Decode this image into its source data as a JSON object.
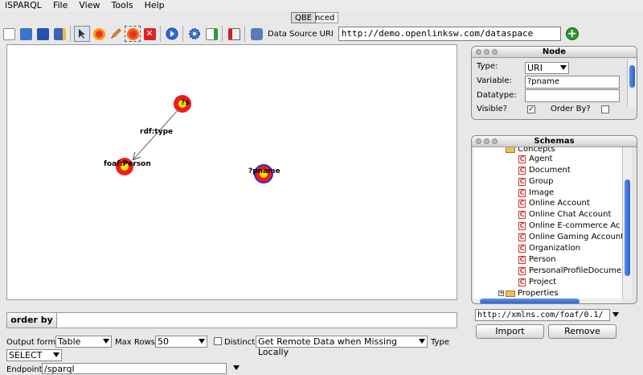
{
  "menu": [
    "iSPARQL",
    "File",
    "View",
    "Tools",
    "Help"
  ],
  "tabs": [
    {
      "label": "QBE",
      "selected": true
    },
    {
      "label": "Advanced",
      "selected": false
    }
  ],
  "toolbar": {
    "icons": [
      "new-icon",
      "open-icon",
      "save-icon",
      "save-as-icon",
      "select-icon",
      "add-node-icon",
      "edit-icon",
      "group-icon",
      "delete-icon",
      "run-icon",
      "settings-icon",
      "load-icon",
      "clear-icon",
      "datasource-icon"
    ],
    "data_source_label": "Data Source URI",
    "data_source_value": "http://demo.openlinksw.com/dataspace"
  },
  "graph": {
    "nodes": [
      {
        "id": "s",
        "label": "?s"
      },
      {
        "id": "person",
        "label": "foaf:Person"
      },
      {
        "id": "pname",
        "label": "?pname"
      }
    ],
    "edges": [
      {
        "from": "s",
        "to": "person",
        "label": "rdf:type"
      }
    ]
  },
  "node_panel": {
    "title": "Node",
    "type_label": "Type:",
    "type_value": "URI",
    "variable_label": "Variable:",
    "variable_value": "?pname",
    "datatype_label": "Datatype:",
    "datatype_value": "",
    "visible_label": "Visible?",
    "visible_checked": true,
    "orderby_label": "Order By?",
    "orderby_checked": false
  },
  "schemas_panel": {
    "title": "Schemas",
    "folder_top": "Concepts",
    "concepts": [
      "Agent",
      "Document",
      "Group",
      "Image",
      "Online Account",
      "Online Chat Account",
      "Online E-commerce Ac",
      "Online Gaming Account",
      "Organization",
      "Person",
      "PersonalProfileDocumen",
      "Project"
    ],
    "folder_bottom": "Properties",
    "schema_uri": "http://xmlns.com/foaf/0.1/",
    "import_label": "Import",
    "remove_label": "Remove"
  },
  "orderby_label": "order by",
  "bottom": {
    "output_format_label": "Output format",
    "output_format_value": "Table",
    "max_rows_label": "Max Rows",
    "max_rows_value": "50",
    "distinct_label": "Distinct",
    "distinct_checked": false,
    "remote_value": "Get Remote Data when Missing Locally",
    "type_label": "Type",
    "type_value": "SELECT",
    "endpoint_label": "Endpoint",
    "endpoint_value": "/sparql"
  }
}
